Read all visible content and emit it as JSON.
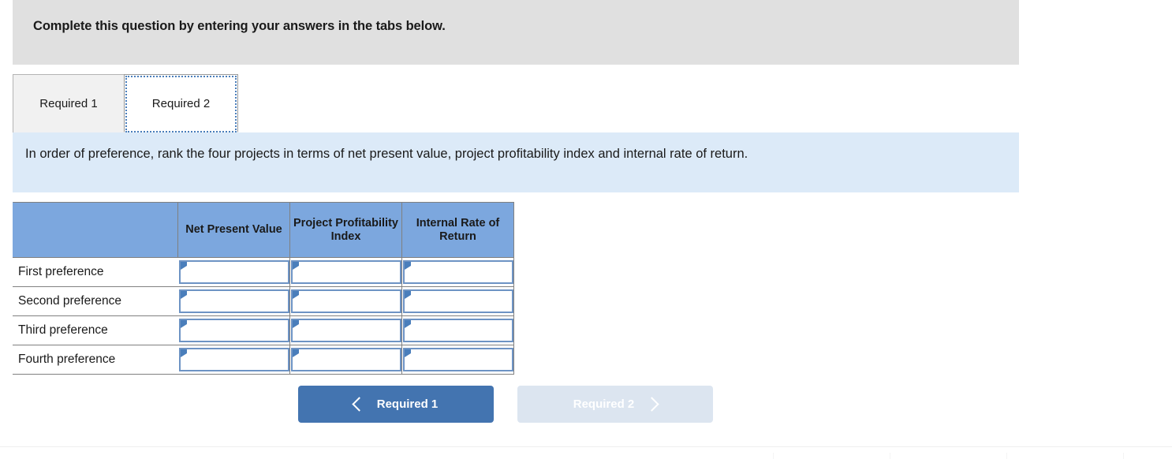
{
  "banner": {
    "title": "Complete this question by entering your answers in the tabs below."
  },
  "tabs": [
    {
      "label": "Required 1",
      "active": false
    },
    {
      "label": "Required 2",
      "active": true
    }
  ],
  "prompt": {
    "text": "In order of preference, rank the four projects in terms of net present value, project profitability index and internal rate of return."
  },
  "table": {
    "corner_header": "",
    "columns": [
      "Net Present Value",
      "Project Profitability Index",
      "Internal Rate of Return"
    ],
    "rows": [
      {
        "label": "First preference",
        "values": [
          "",
          "",
          ""
        ]
      },
      {
        "label": "Second preference",
        "values": [
          "",
          "",
          ""
        ]
      },
      {
        "label": "Third preference",
        "values": [
          "",
          "",
          ""
        ]
      },
      {
        "label": "Fourth preference",
        "values": [
          "",
          "",
          ""
        ]
      }
    ]
  },
  "navigation": {
    "prev_label": "Required 1",
    "next_label": "Required 2",
    "prev_icon": "chevron-left-icon",
    "next_icon": "chevron-right-icon"
  },
  "colors": {
    "banner_bg": "#e0e0e0",
    "prompt_bg": "#dceaf8",
    "table_header_bg": "#7ca7de",
    "input_border": "#6d93c4",
    "marker": "#4a7ebb",
    "nav_active_bg": "#4374b0",
    "nav_disabled_bg": "#dce5f0"
  }
}
